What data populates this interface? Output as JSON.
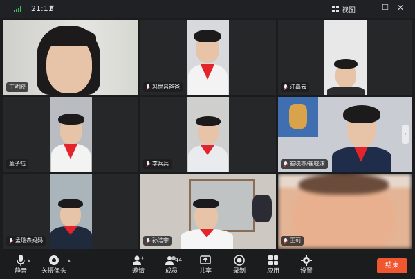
{
  "status": {
    "time": "21:11"
  },
  "header": {
    "view_label": "视图"
  },
  "participants": [
    {
      "name": "丁明皎",
      "muted": false
    },
    {
      "name": "冯世昌爸爸",
      "muted": true
    },
    {
      "name": "汪嘉云",
      "muted": true
    },
    {
      "name": "菫子钰",
      "muted": false
    },
    {
      "name": "李兵兵",
      "muted": true
    },
    {
      "name": "崔晓亦/崔晓沫",
      "muted": true
    },
    {
      "name": "孟瑞森妈妈",
      "muted": true
    },
    {
      "name": "孙浩宇",
      "muted": true
    },
    {
      "name": "王莉",
      "muted": true
    }
  ],
  "toolbar": {
    "mute_label": "静音",
    "camera_label": "关摄像头",
    "invite_label": "邀请",
    "members_label": "成员",
    "members_count": "44",
    "share_label": "共享",
    "record_label": "录制",
    "apps_label": "应用",
    "settings_label": "设置",
    "end_label": "结束"
  },
  "colors": {
    "accent_end": "#f0572f",
    "background": "#1b1c1e",
    "signal": "#3bbf5b"
  }
}
